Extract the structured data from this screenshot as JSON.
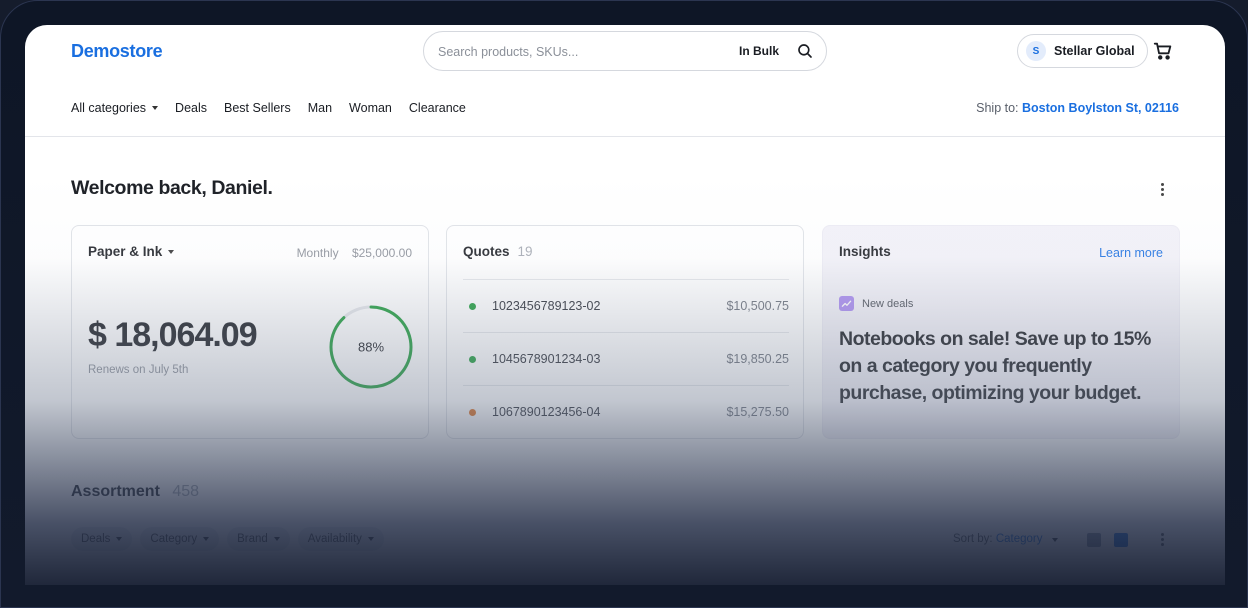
{
  "header": {
    "logo": "Demostore",
    "search_placeholder": "Search products, SKUs...",
    "bulk_label": "In Bulk",
    "account": {
      "initial": "S",
      "name": "Stellar Global"
    }
  },
  "nav": {
    "items": [
      "All categories",
      "Deals",
      "Best Sellers",
      "Man",
      "Woman",
      "Clearance"
    ],
    "ship_label": "Ship to:",
    "ship_address": "Boston Boylston St, 02116"
  },
  "welcome": "Welcome back, Daniel.",
  "budget_card": {
    "title": "Paper & Ink",
    "period": "Monthly",
    "limit": "$25,000.00",
    "amount": "$ 18,064.09",
    "renew": "Renews on July 5th",
    "progress_label": "88%",
    "progress": 0.88
  },
  "quotes_card": {
    "title": "Quotes",
    "count": "19",
    "rows": [
      {
        "id": "1023456789123-02",
        "amount": "$10,500.75",
        "status_color": "#1f9d3c"
      },
      {
        "id": "1045678901234-03",
        "amount": "$19,850.25",
        "status_color": "#1f9d3c"
      },
      {
        "id": "1067890123456-04",
        "amount": "$15,275.50",
        "status_color": "#e07020"
      }
    ]
  },
  "insights_card": {
    "title": "Insights",
    "learn_more": "Learn more",
    "badge": "New deals",
    "message": "Notebooks on sale! Save up to 15% on a category you frequently purchase, optimizing your budget."
  },
  "assortment": {
    "title": "Assortment",
    "count": "458",
    "filters": [
      "Deals",
      "Category",
      "Brand",
      "Availability"
    ],
    "sort_label": "Sort by:",
    "sort_value": "Category"
  },
  "colors": {
    "accent": "#1a6fe0",
    "progress": "#1f9d3c"
  }
}
